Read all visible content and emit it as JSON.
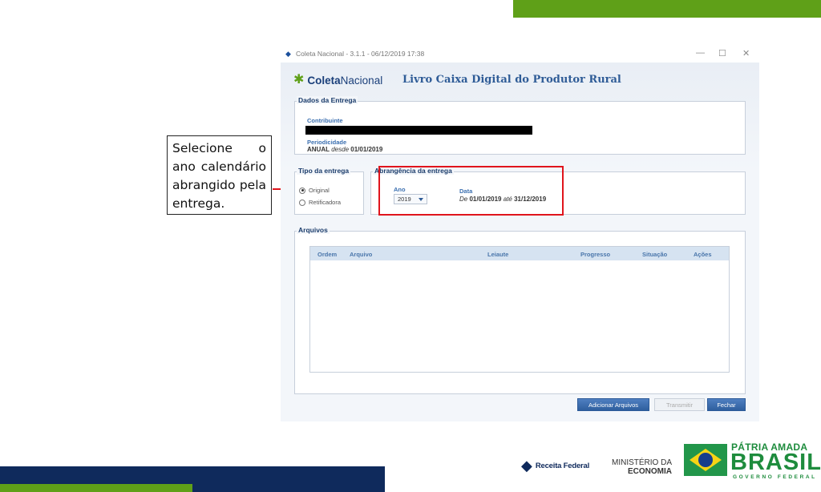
{
  "callout": {
    "text": "Selecione o ano calendário abrangido pela entrega."
  },
  "window": {
    "title": "Coleta Nacional - 3.1.1 - 06/12/2019 17:38",
    "minimize": "—",
    "maximize": "☐",
    "close": "✕"
  },
  "app": {
    "brand_bold": "Coleta",
    "brand_light": "Nacional",
    "title": "Livro Caixa Digital do Produtor Rural"
  },
  "dados": {
    "legend": "Dados da Entrega",
    "contribuinte_label": "Contribuinte",
    "periodicidade_label": "Periodicidade",
    "periodicidade_value": "ANUAL",
    "desde": "desde",
    "desde_date": "01/01/2019"
  },
  "tipo": {
    "legend": "Tipo da entrega",
    "options": [
      "Original",
      "Retificadora"
    ],
    "selected": "Original"
  },
  "abrangencia": {
    "legend": "Abrangência da entrega",
    "ano_label": "Ano",
    "ano_value": "2019",
    "data_label": "Data",
    "de": "De",
    "start": "01/01/2019",
    "ate": "até",
    "end": "31/12/2019"
  },
  "arquivos": {
    "legend": "Arquivos",
    "columns": [
      "Ordem",
      "Arquivo",
      "Leiaute",
      "Progresso",
      "Situação",
      "Ações"
    ]
  },
  "buttons": {
    "add": "Adicionar Arquivos",
    "transmit": "Transmitir",
    "close": "Fechar"
  },
  "footer": {
    "receita": "Receita Federal",
    "ministerio_1": "MINISTÉRIO DA",
    "ministerio_2": "ECONOMIA",
    "patria": "PÁTRIA AMADA",
    "brasil": "BRASIL",
    "governo": "GOVERNO FEDERAL"
  },
  "colors": {
    "green": "#5fa018",
    "navy": "#0f2a5c",
    "highlight_red": "#e0141c"
  }
}
